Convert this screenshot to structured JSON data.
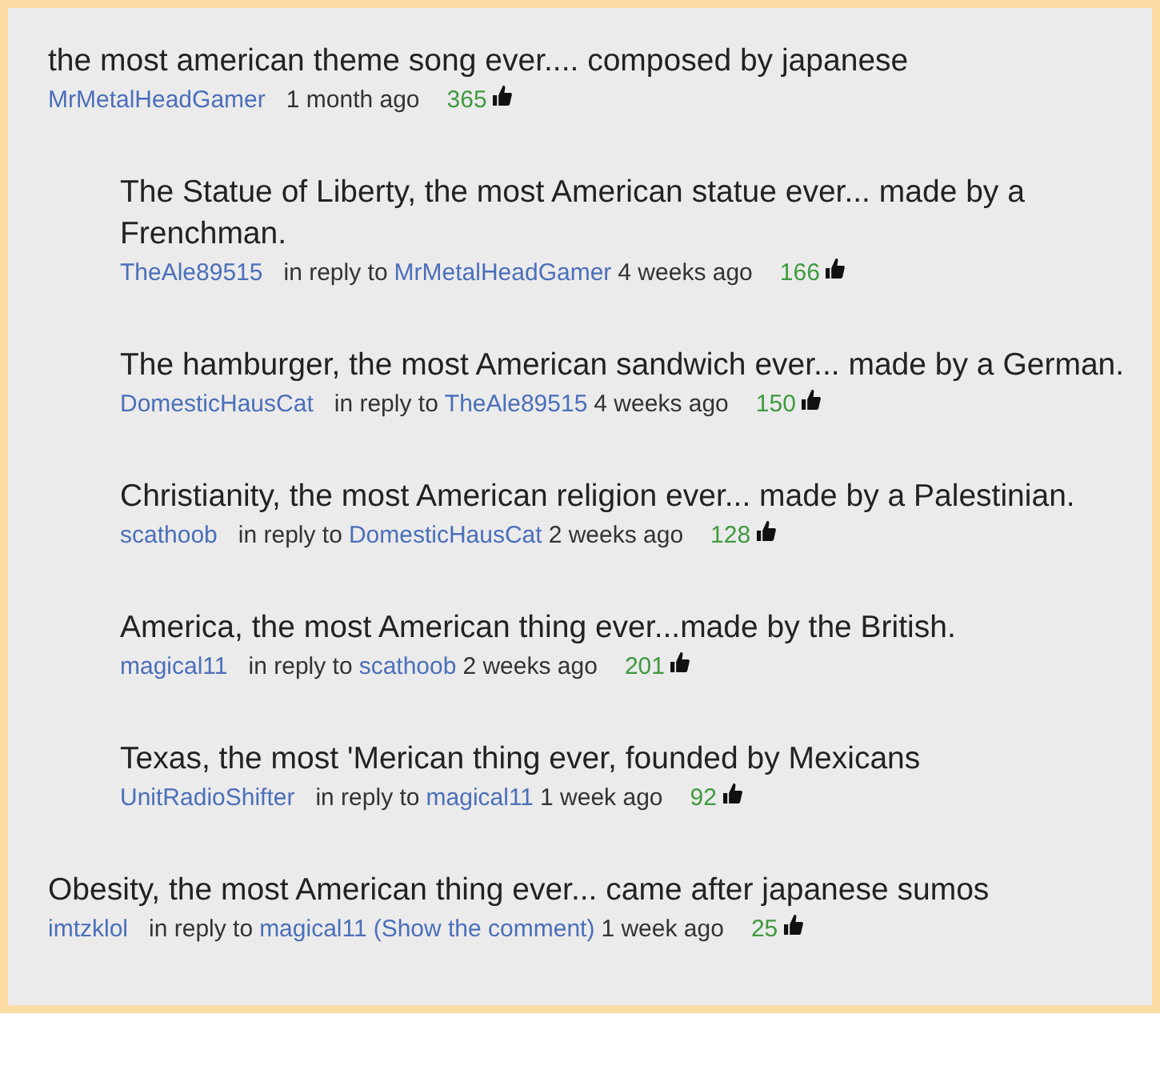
{
  "comments": [
    {
      "text": "the most american theme song ever.... composed by japanese",
      "author": "MrMetalHeadGamer",
      "time": "1 month ago",
      "likes": "365",
      "children": [
        {
          "text": "The Statue of Liberty, the most American statue ever... made by a Frenchman.",
          "author": "TheAle89515",
          "reply_label": "in reply to",
          "reply_to": "MrMetalHeadGamer",
          "time": "4 weeks ago",
          "likes": "166"
        },
        {
          "text": "The hamburger, the most American sandwich ever... made by a German.",
          "author": "DomesticHausCat",
          "reply_label": "in reply to",
          "reply_to": "TheAle89515",
          "time": "4 weeks ago",
          "likes": "150"
        },
        {
          "text": "Christianity, the most American religion ever... made by a Palestinian.",
          "author": "scathoob",
          "reply_label": "in reply to",
          "reply_to": "DomesticHausCat",
          "time": "2 weeks ago",
          "likes": "128"
        },
        {
          "text": "America, the most American thing ever...made by the British.",
          "author": "magical11",
          "reply_label": "in reply to",
          "reply_to": "scathoob",
          "time": "2 weeks ago",
          "likes": "201"
        },
        {
          "text": "Texas, the most 'Merican thing ever, founded by Mexicans",
          "author": "UnitRadioShifter",
          "reply_label": "in reply to",
          "reply_to": "magical11",
          "time": "1 week ago",
          "likes": "92"
        }
      ]
    },
    {
      "text": "Obesity, the most American thing ever... came after japanese sumos",
      "author": "imtzklol",
      "reply_label": "in reply to",
      "reply_to": "magical11",
      "show_comment": "(Show the comment)",
      "time": "1 week ago",
      "likes": "25"
    }
  ]
}
